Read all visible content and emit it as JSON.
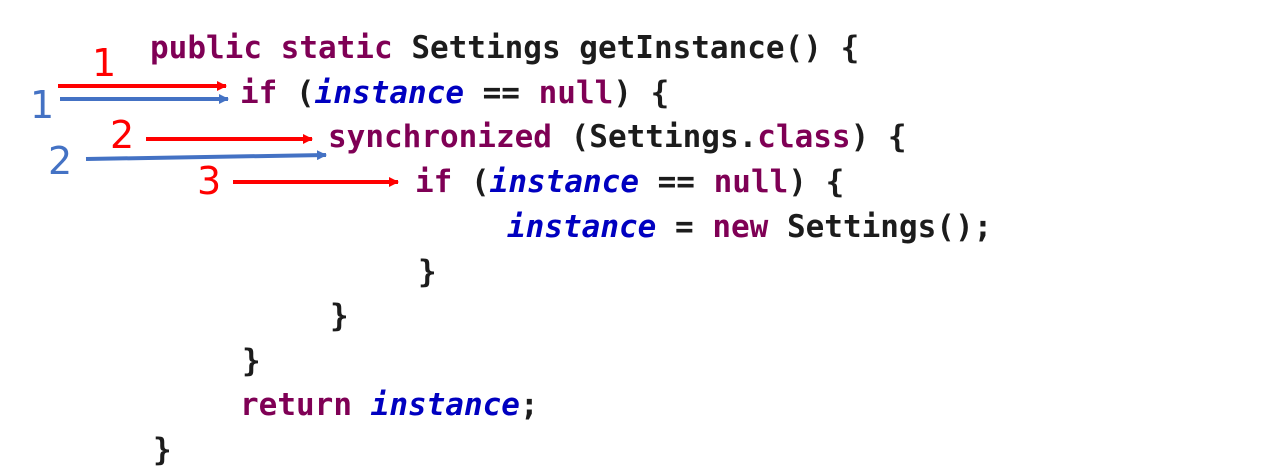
{
  "code": {
    "line1": {
      "kw_public": "public",
      "kw_static": "static",
      "rest": "Settings getInstance() {"
    },
    "line2": {
      "kw_if": "if",
      "open": "(",
      "var": "instance",
      "op": " == ",
      "kw_null": "null",
      "close": ") {"
    },
    "line3": {
      "kw_sync": "synchronized",
      "open": " (Settings.",
      "kw_class": "class",
      "close": ") {"
    },
    "line4": {
      "kw_if": "if",
      "open": "(",
      "var": "instance",
      "op": " == ",
      "kw_null": "null",
      "close": ") {"
    },
    "line5": {
      "var": "instance",
      "assign": " = ",
      "kw_new": "new",
      "rest": " Settings();"
    },
    "line6": {
      "brace": "}"
    },
    "line7": {
      "brace": "}"
    },
    "line8": {
      "brace": "}"
    },
    "line9": {
      "kw_return": "return",
      "var": "instance",
      "semi": ";"
    },
    "line10": {
      "brace": "}"
    }
  },
  "markers": {
    "red": [
      "1",
      "2",
      "3"
    ],
    "blue": [
      "1",
      "2"
    ]
  },
  "colors": {
    "keyword": "#7f0055",
    "variable": "#0000c0",
    "red_arrow": "#ff0000",
    "blue_arrow": "#4472c4"
  }
}
